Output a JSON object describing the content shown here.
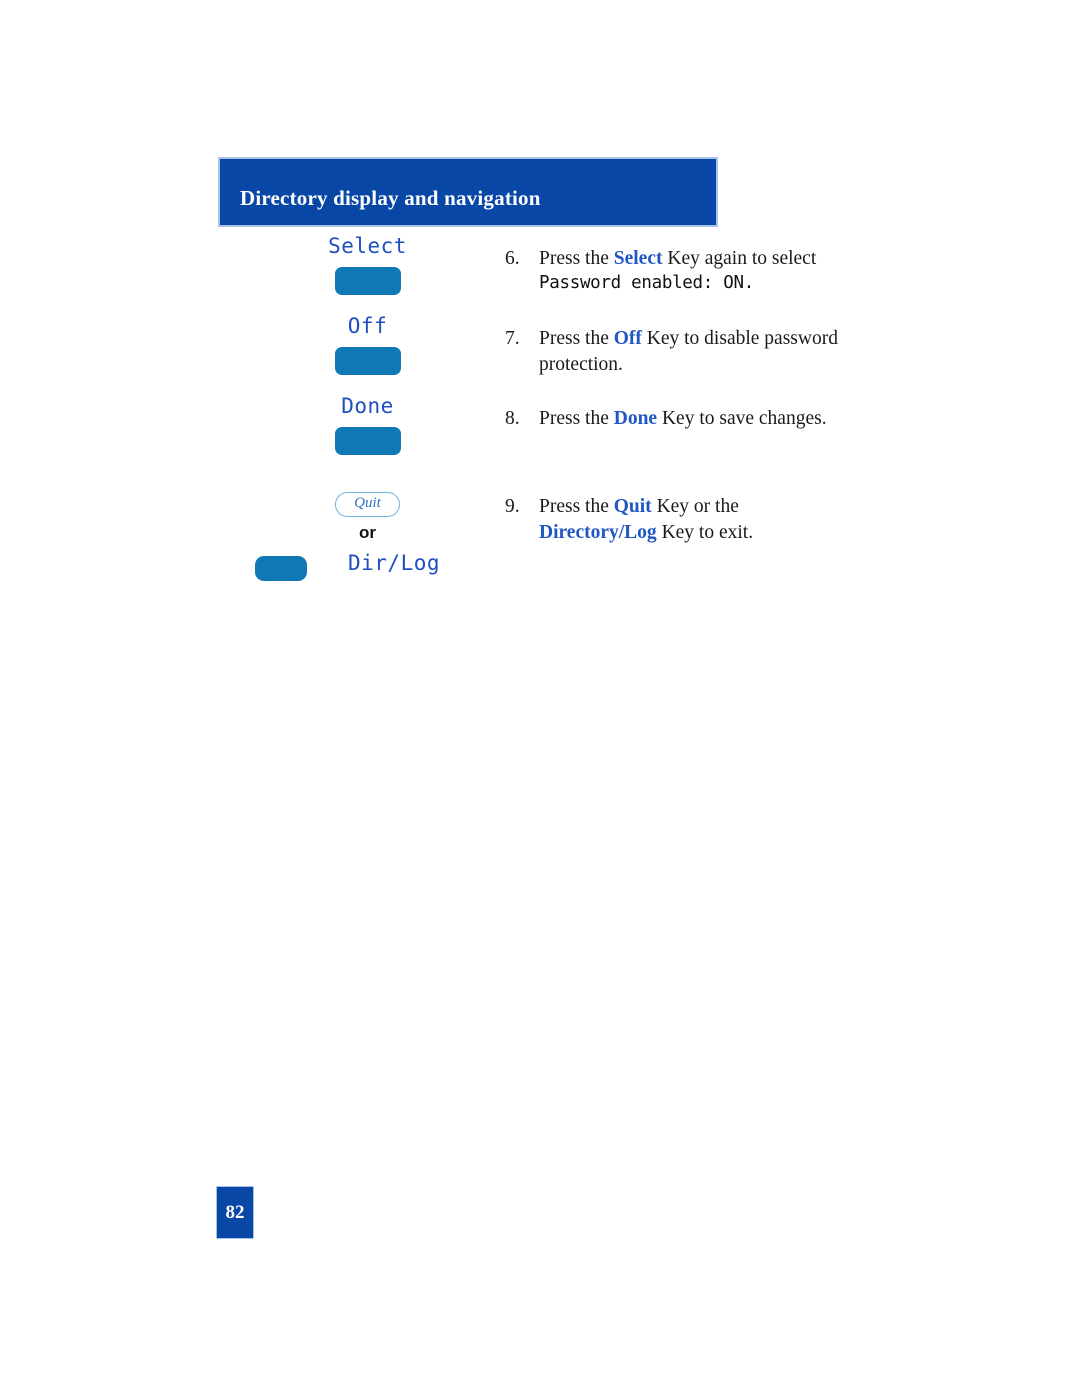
{
  "header": {
    "title": "Directory display and navigation",
    "bg_color": "#0847a6",
    "border_color": "#a8c4e8",
    "text_color": "#ffffff"
  },
  "colors": {
    "keyword_blue": "#1f57c4",
    "lcd_blue": "#1f4fbf",
    "softkey_blue": "#0f79b5",
    "quit_outline": "#74b4dd"
  },
  "steps": [
    {
      "number": "6.",
      "softkey_label": "Select",
      "text_before": "Press the ",
      "keyword": "Select",
      "text_after": " Key again to select",
      "lcd_line": "Password enabled: ON.",
      "second_line": ""
    },
    {
      "number": "7.",
      "softkey_label": "Off",
      "text_before": "Press the ",
      "keyword": "Off",
      "text_after": " Key to disable password",
      "lcd_line": "",
      "second_line": "protection."
    },
    {
      "number": "8.",
      "softkey_label": "Done",
      "text_before": "Press the ",
      "keyword": "Done",
      "text_after": " Key to save changes.",
      "lcd_line": "",
      "second_line": ""
    },
    {
      "number": "9.",
      "quit_label": "Quit",
      "or_label": "or",
      "dirlog_label": "Dir/Log",
      "text_before": "Press the ",
      "keyword": "Quit",
      "text_after": " Key or the",
      "keyword2": "Directory/Log",
      "text_after2": " Key to exit."
    }
  ],
  "footer": {
    "page_number": "82"
  }
}
